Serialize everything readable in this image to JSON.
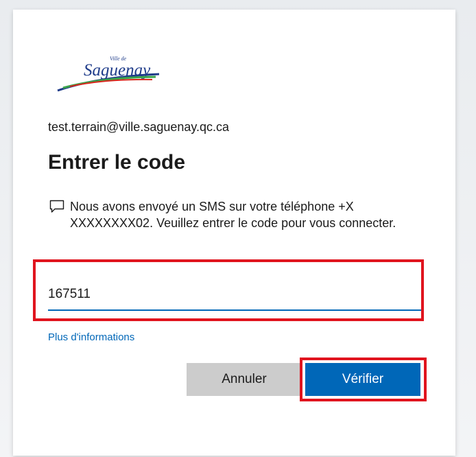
{
  "brand": {
    "logo_small_text": "Ville de",
    "logo_text": "Saguenay",
    "colors": {
      "logo_text": "#1f3c8a",
      "swoosh_blue": "#1f3c8a",
      "swoosh_green": "#3aa34a",
      "swoosh_red": "#d9261c"
    }
  },
  "account": {
    "email": "test.terrain@ville.saguenay.qc.ca"
  },
  "page": {
    "title": "Entrer le code",
    "message_icon": "chat-bubble-icon",
    "message": "Nous avons envoyé un SMS sur votre téléphone +X XXXXXXXX02. Veuillez entrer le code pour vous connecter."
  },
  "code_field": {
    "value": "167511"
  },
  "links": {
    "more_info": "Plus d'informations"
  },
  "buttons": {
    "cancel": "Annuler",
    "verify": "Vérifier"
  },
  "colors": {
    "accent": "#0067b8",
    "highlight": "#e0141e",
    "cancel_bg": "#cccccc"
  }
}
